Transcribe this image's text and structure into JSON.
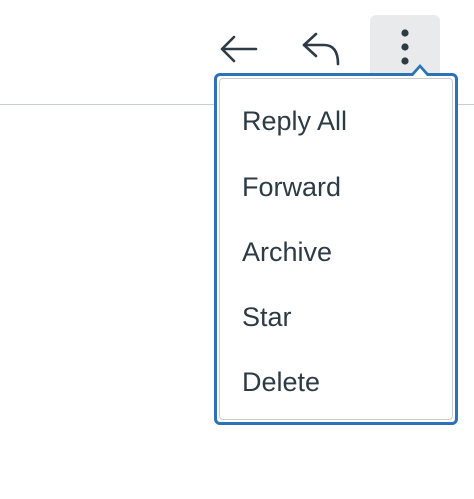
{
  "toolbar": {
    "back_icon": "arrow-left-icon",
    "reply_icon": "reply-icon",
    "more_icon": "more-vertical-icon"
  },
  "menu": {
    "items": [
      {
        "label": "Reply All"
      },
      {
        "label": "Forward"
      },
      {
        "label": "Archive"
      },
      {
        "label": "Star"
      },
      {
        "label": "Delete"
      }
    ]
  },
  "colors": {
    "accent_border": "#2b72b7",
    "text": "#2d3b45",
    "active_button_bg": "#e8eaec",
    "divider": "#c7cdd1"
  }
}
